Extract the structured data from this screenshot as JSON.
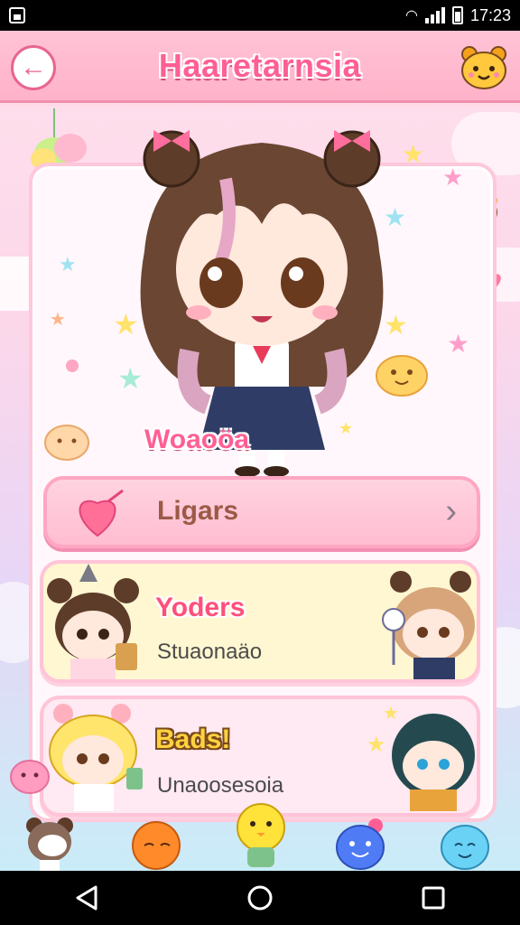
{
  "status_bar": {
    "time": "17:23"
  },
  "header": {
    "title": "Haaretarnsia"
  },
  "character": {
    "name": "Woaoöa"
  },
  "menu": {
    "likes": {
      "label": "Ligars"
    },
    "yoders": {
      "title": "Yoders",
      "subtitle": "Stuaonaäo"
    },
    "bads": {
      "title": "Bads!",
      "subtitle": "Unaoosesoia"
    }
  },
  "colors": {
    "accent": "#ff5f94",
    "header_bg": "#ffb2c9",
    "card_bg": "#fff7fb"
  },
  "icons": [
    "back-arrow-icon",
    "bear-face-icon",
    "heart-icon",
    "chevron-right-icon",
    "nav-back-icon",
    "nav-home-icon",
    "nav-recent-icon"
  ]
}
